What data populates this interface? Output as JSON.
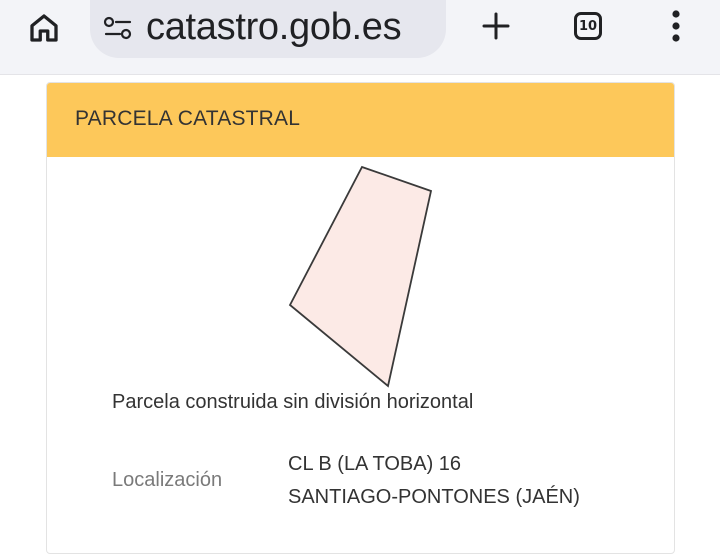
{
  "browser": {
    "url": "catastro.gob.es",
    "tab_count": "10",
    "icons": {
      "home": "home-icon",
      "site_settings": "tune-icon",
      "new_tab": "plus-icon",
      "menu": "more-vert-icon"
    }
  },
  "card": {
    "title": "PARCELA CATASTRAL",
    "header_color": "#fdc85a",
    "parcel_fill": "#fceae6",
    "description": "Parcela construida sin división horizontal",
    "location_label": "Localización",
    "location_line1": "CL B (LA TOBA) 16",
    "location_line2": "SANTIAGO-PONTONES (JAÉN)"
  }
}
